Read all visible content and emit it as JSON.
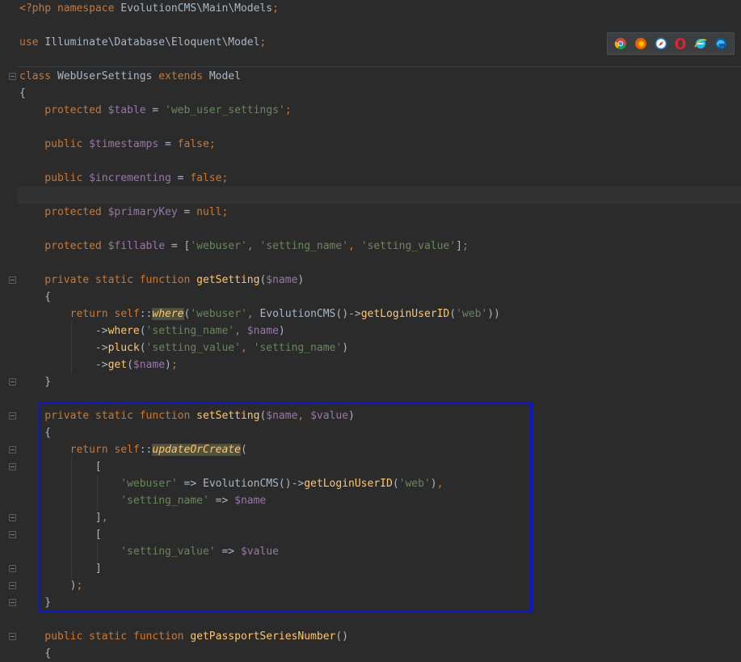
{
  "editor": {
    "language": "php",
    "current_line_index": 9,
    "lines": [
      [
        {
          "t": "<?php ",
          "c": "kw"
        },
        {
          "t": "namespace ",
          "c": "kw"
        },
        {
          "t": "EvolutionCMS\\Main\\Models",
          "c": "plain"
        },
        {
          "t": ";",
          "c": "kw"
        }
      ],
      [],
      [
        {
          "t": "use ",
          "c": "kw"
        },
        {
          "t": "Illuminate\\Database\\Eloquent\\Model",
          "c": "plain"
        },
        {
          "t": ";",
          "c": "kw"
        }
      ],
      [],
      [
        {
          "t": "class ",
          "c": "kw"
        },
        {
          "t": "WebUserSettings ",
          "c": "plain"
        },
        {
          "t": "extends ",
          "c": "kw"
        },
        {
          "t": "Model",
          "c": "plain"
        }
      ],
      [
        {
          "t": "{",
          "c": "plain"
        }
      ],
      [
        {
          "t": "    protected ",
          "c": "kw"
        },
        {
          "t": "$table",
          "c": "var"
        },
        {
          "t": " = ",
          "c": "plain"
        },
        {
          "t": "'web_user_settings'",
          "c": "str"
        },
        {
          "t": ";",
          "c": "kw"
        }
      ],
      [],
      [
        {
          "t": "    public ",
          "c": "kw"
        },
        {
          "t": "$timestamps",
          "c": "var"
        },
        {
          "t": " = ",
          "c": "plain"
        },
        {
          "t": "false",
          "c": "kw"
        },
        {
          "t": ";",
          "c": "kw"
        }
      ],
      [],
      [
        {
          "t": "    public ",
          "c": "kw"
        },
        {
          "t": "$incrementing",
          "c": "var"
        },
        {
          "t": " = ",
          "c": "plain"
        },
        {
          "t": "false",
          "c": "kw"
        },
        {
          "t": ";",
          "c": "kw"
        }
      ],
      [],
      [
        {
          "t": "    protected ",
          "c": "kw"
        },
        {
          "t": "$primaryKey",
          "c": "var"
        },
        {
          "t": " = ",
          "c": "plain"
        },
        {
          "t": "null",
          "c": "kw"
        },
        {
          "t": ";",
          "c": "kw"
        }
      ],
      [],
      [
        {
          "t": "    protected ",
          "c": "kw"
        },
        {
          "t": "$fillable",
          "c": "var"
        },
        {
          "t": " = [",
          "c": "plain"
        },
        {
          "t": "'webuser'",
          "c": "str"
        },
        {
          "t": ", ",
          "c": "kw"
        },
        {
          "t": "'setting_name'",
          "c": "str"
        },
        {
          "t": ", ",
          "c": "kw"
        },
        {
          "t": "'setting_value'",
          "c": "str"
        },
        {
          "t": "]",
          "c": "plain"
        },
        {
          "t": ";",
          "c": "kw"
        }
      ],
      [],
      [
        {
          "t": "    private static function ",
          "c": "kw"
        },
        {
          "t": "getSetting",
          "c": "fn"
        },
        {
          "t": "(",
          "c": "plain"
        },
        {
          "t": "$name",
          "c": "var"
        },
        {
          "t": ")",
          "c": "plain"
        }
      ],
      [
        {
          "t": "    {",
          "c": "plain"
        }
      ],
      [
        {
          "t": "        return ",
          "c": "kw"
        },
        {
          "t": "self",
          "c": "kw"
        },
        {
          "t": "::",
          "c": "plain"
        },
        {
          "t": "where",
          "c": "hl-fn"
        },
        {
          "t": "(",
          "c": "plain"
        },
        {
          "t": "'webuser'",
          "c": "str"
        },
        {
          "t": ", ",
          "c": "kw"
        },
        {
          "t": "EvolutionCMS",
          "c": "plain"
        },
        {
          "t": "()->",
          "c": "plain"
        },
        {
          "t": "getLoginUserID",
          "c": "fn"
        },
        {
          "t": "(",
          "c": "plain"
        },
        {
          "t": "'web'",
          "c": "str"
        },
        {
          "t": "))",
          "c": "plain"
        }
      ],
      [
        {
          "t": "            ->",
          "c": "plain"
        },
        {
          "t": "where",
          "c": "fn"
        },
        {
          "t": "(",
          "c": "plain"
        },
        {
          "t": "'setting_name'",
          "c": "str"
        },
        {
          "t": ", ",
          "c": "kw"
        },
        {
          "t": "$name",
          "c": "var"
        },
        {
          "t": ")",
          "c": "plain"
        }
      ],
      [
        {
          "t": "            ->",
          "c": "plain"
        },
        {
          "t": "pluck",
          "c": "fn"
        },
        {
          "t": "(",
          "c": "plain"
        },
        {
          "t": "'setting_value'",
          "c": "str"
        },
        {
          "t": ", ",
          "c": "kw"
        },
        {
          "t": "'setting_name'",
          "c": "str"
        },
        {
          "t": ")",
          "c": "plain"
        }
      ],
      [
        {
          "t": "            ->",
          "c": "plain"
        },
        {
          "t": "get",
          "c": "fn"
        },
        {
          "t": "(",
          "c": "plain"
        },
        {
          "t": "$name",
          "c": "var"
        },
        {
          "t": ")",
          "c": "plain"
        },
        {
          "t": ";",
          "c": "kw"
        }
      ],
      [
        {
          "t": "    }",
          "c": "plain"
        }
      ],
      [],
      [
        {
          "t": "    private static function ",
          "c": "kw"
        },
        {
          "t": "setSetting",
          "c": "fn"
        },
        {
          "t": "(",
          "c": "plain"
        },
        {
          "t": "$name",
          "c": "var"
        },
        {
          "t": ", ",
          "c": "kw"
        },
        {
          "t": "$value",
          "c": "var"
        },
        {
          "t": ")",
          "c": "plain"
        }
      ],
      [
        {
          "t": "    {",
          "c": "plain"
        }
      ],
      [
        {
          "t": "        return ",
          "c": "kw"
        },
        {
          "t": "self",
          "c": "kw"
        },
        {
          "t": "::",
          "c": "plain"
        },
        {
          "t": "updateOrCreate",
          "c": "hl-fn"
        },
        {
          "t": "(",
          "c": "plain"
        }
      ],
      [
        {
          "t": "            [",
          "c": "plain"
        }
      ],
      [
        {
          "t": "                ",
          "c": "plain"
        },
        {
          "t": "'webuser'",
          "c": "str"
        },
        {
          "t": " => ",
          "c": "plain"
        },
        {
          "t": "EvolutionCMS",
          "c": "plain"
        },
        {
          "t": "()->",
          "c": "plain"
        },
        {
          "t": "getLoginUserID",
          "c": "fn"
        },
        {
          "t": "(",
          "c": "plain"
        },
        {
          "t": "'web'",
          "c": "str"
        },
        {
          "t": ")",
          "c": "plain"
        },
        {
          "t": ",",
          "c": "kw"
        }
      ],
      [
        {
          "t": "                ",
          "c": "plain"
        },
        {
          "t": "'setting_name'",
          "c": "str"
        },
        {
          "t": " => ",
          "c": "plain"
        },
        {
          "t": "$name",
          "c": "var"
        }
      ],
      [
        {
          "t": "            ]",
          "c": "plain"
        },
        {
          "t": ",",
          "c": "kw"
        }
      ],
      [
        {
          "t": "            [",
          "c": "plain"
        }
      ],
      [
        {
          "t": "                ",
          "c": "plain"
        },
        {
          "t": "'setting_value'",
          "c": "str"
        },
        {
          "t": " => ",
          "c": "plain"
        },
        {
          "t": "$value",
          "c": "var"
        }
      ],
      [
        {
          "t": "            ]",
          "c": "plain"
        }
      ],
      [
        {
          "t": "        )",
          "c": "plain"
        },
        {
          "t": ";",
          "c": "kw"
        }
      ],
      [
        {
          "t": "    }",
          "c": "plain"
        }
      ],
      [],
      [
        {
          "t": "    public static function ",
          "c": "kw"
        },
        {
          "t": "getPassportSeriesNumber",
          "c": "fn"
        },
        {
          "t": "()",
          "c": "plain"
        }
      ],
      [
        {
          "t": "    {",
          "c": "plain"
        }
      ]
    ]
  },
  "browser_bar": {
    "icons": [
      "chrome-icon",
      "firefox-icon",
      "safari-icon",
      "opera-icon",
      "ie-icon",
      "edge-icon"
    ]
  },
  "colors": {
    "background": "#2b2b2b",
    "keyword": "#cc7832",
    "variable": "#9876aa",
    "string": "#6a8759",
    "function": "#ffc66d",
    "text": "#a9b7c6",
    "highlight_box": "#0b18cf"
  }
}
